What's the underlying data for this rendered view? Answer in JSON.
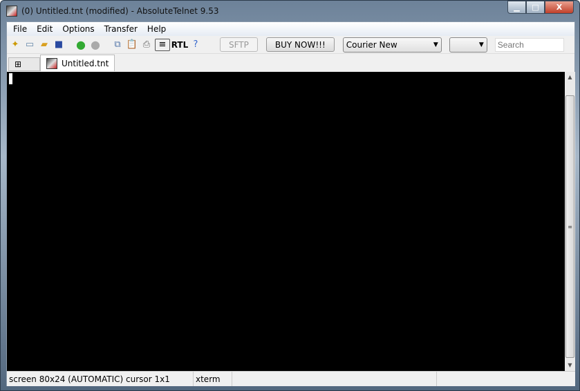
{
  "window": {
    "title": "(0) Untitled.tnt (modified) - AbsoluteTelnet 9.53",
    "minimize": "▁",
    "maximize": "□",
    "close": "X"
  },
  "menu": [
    "File",
    "Edit",
    "Options",
    "Transfer",
    "Help"
  ],
  "toolbar": {
    "sftp": "SFTP",
    "buy": "BUY NOW!!!",
    "rtl": "RTL",
    "font": "Courier New",
    "size": "",
    "search_placeholder": "Search"
  },
  "tabs": {
    "active": "Untitled.tnt"
  },
  "status": {
    "screen": "screen 80x24 (AUTOMATIC) cursor 1x1",
    "term": "xterm",
    "extra1": "",
    "extra2": ""
  }
}
